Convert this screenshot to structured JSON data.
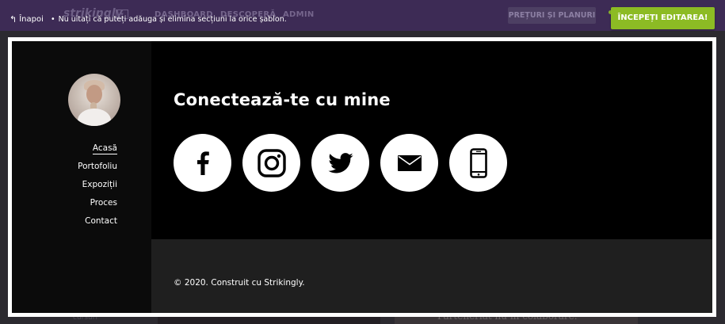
{
  "topbar": {
    "back_label": "Înapoi",
    "notice": "Nu uitați că puteți adăuga și elimina secțiuni la orice șablon.",
    "logo_text": "strikingly",
    "nav_items": [
      "DASHBOARD",
      "DESCOPERĂ",
      "ADMIN"
    ],
    "pricing_label": "PREȚURI ȘI PLANURI",
    "start_label": "ÎNCEPEȚI EDITAREA!",
    "colors": {
      "bar": "#3d2b55",
      "start_button": "#8cbb24"
    }
  },
  "sidebar": {
    "menu": [
      {
        "label": "Acasă",
        "active": true
      },
      {
        "label": "Portofoliu"
      },
      {
        "label": "Expoziții"
      },
      {
        "label": "Proces"
      },
      {
        "label": "Contact"
      }
    ]
  },
  "main": {
    "heading": "Conectează-te cu mine",
    "socials": [
      {
        "icon": "facebook-icon"
      },
      {
        "icon": "instagram-icon"
      },
      {
        "icon": "twitter-icon"
      },
      {
        "icon": "email-icon"
      },
      {
        "icon": "phone-icon"
      }
    ]
  },
  "footer": {
    "copyright": "© 2020. Construit cu Strikingly."
  },
  "background_page": {
    "left_text": "cursuri",
    "card_text": "Parteneriat nu în colaborare."
  }
}
